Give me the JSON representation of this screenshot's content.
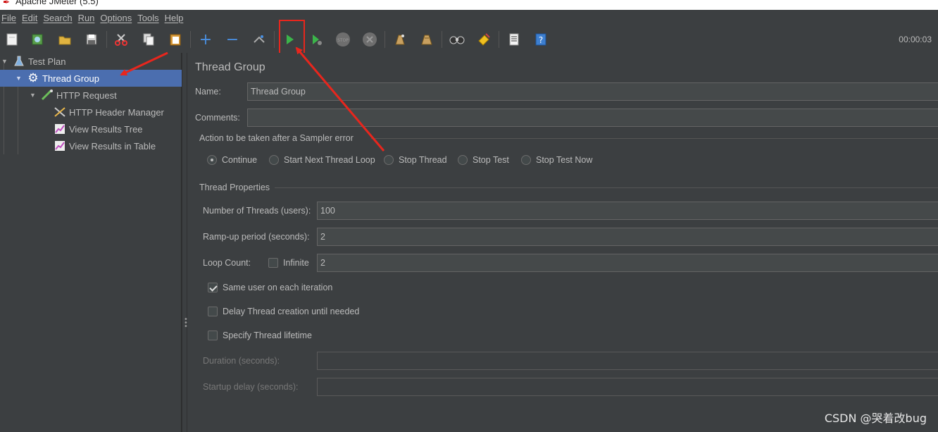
{
  "window": {
    "title": "Apache JMeter (5.5)"
  },
  "menu": [
    "File",
    "Edit",
    "Search",
    "Run",
    "Options",
    "Tools",
    "Help"
  ],
  "toolbar": {
    "timer": "00:00:03",
    "buttons": [
      "new-icon",
      "templates-icon",
      "open-icon",
      "save-icon",
      "cut-icon",
      "copy-icon",
      "paste-icon",
      "expand-icon",
      "collapse-icon",
      "toggle-icon",
      "start-icon",
      "start-no-pauses-icon",
      "stop-icon",
      "shutdown-icon",
      "clear-icon",
      "clear-all-icon",
      "search-icon",
      "reset-search-icon",
      "function-helper-icon",
      "help-icon"
    ]
  },
  "tree": {
    "items": [
      {
        "label": "Test Plan",
        "icon": "flask-icon"
      },
      {
        "label": "Thread Group",
        "icon": "gear-icon",
        "selected": true
      },
      {
        "label": "HTTP Request",
        "icon": "pipette-icon"
      },
      {
        "label": "HTTP Header Manager",
        "icon": "tools-icon"
      },
      {
        "label": "View Results Tree",
        "icon": "chart-icon"
      },
      {
        "label": "View Results in Table",
        "icon": "chart-icon"
      }
    ]
  },
  "form": {
    "panel_title": "Thread Group",
    "name_label": "Name:",
    "name_value": "Thread Group",
    "comments_label": "Comments:",
    "comments_value": "",
    "sampler_error": {
      "title": "Action to be taken after a Sampler error",
      "options": [
        "Continue",
        "Start Next Thread Loop",
        "Stop Thread",
        "Stop Test",
        "Stop Test Now"
      ],
      "selected": "Continue"
    },
    "thread_props": {
      "title": "Thread Properties",
      "threads_label": "Number of Threads (users):",
      "threads_value": "100",
      "rampup_label": "Ramp-up period (seconds):",
      "rampup_value": "2",
      "loop_label": "Loop Count:",
      "infinite_label": "Infinite",
      "loop_value": "2",
      "same_user_label": "Same user on each iteration",
      "delay_label": "Delay Thread creation until needed",
      "lifetime_label": "Specify Thread lifetime",
      "duration_label": "Duration (seconds):",
      "startup_label": "Startup delay (seconds):"
    }
  },
  "watermark": "CSDN @哭着改bug",
  "colors": {
    "accent": "#4b6eaf",
    "annotation": "#e8261d"
  }
}
